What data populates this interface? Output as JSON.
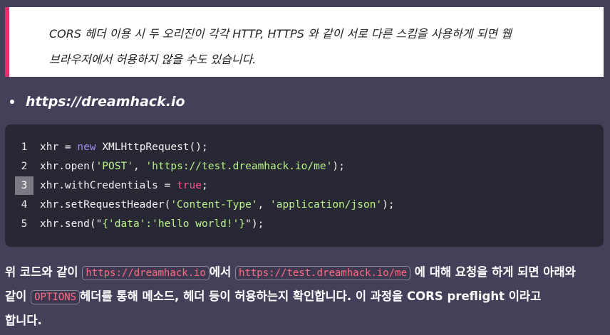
{
  "quote": {
    "line1": "CORS 헤더 이용 시 두 오리진이 각각 HTTP, HTTPS 와 같이 서로 다른 스킴을 사용하게 되면 웹",
    "line2": "브라우저에서 허용하지 않을 수도 있습니다."
  },
  "bullet": {
    "text": "https://dreamhack.io"
  },
  "code": {
    "active_line": 3,
    "lines": [
      {
        "num": "1",
        "p1": "xhr = ",
        "kw": "new",
        "p2": " XMLHttpRequest();"
      },
      {
        "num": "2",
        "p1": "xhr.open(",
        "s1": "'POST'",
        "p2": ", ",
        "s2": "'https://test.dreamhack.io/me'",
        "p3": ");"
      },
      {
        "num": "3",
        "p1": "xhr.withCredentials = ",
        "lit": "true",
        "p2": ";"
      },
      {
        "num": "4",
        "p1": "xhr.setRequestHeader(",
        "s1": "'Content-Type'",
        "p2": ", ",
        "s2": "'application/json'",
        "p3": ");"
      },
      {
        "num": "5",
        "p1": "xhr.send(\"",
        "s1": "{'data':'hello world!'}",
        "p2": "\");"
      }
    ]
  },
  "paragraph": {
    "t1": "위 코드와 같이 ",
    "c1": "https://dreamhack.io",
    "t2": "에서 ",
    "c2": "https://test.dreamhack.io/me",
    "t3": " 에 대해 요청을 하게 되면 아래와",
    "t4": "같이 ",
    "c3": "OPTIONS",
    "t5": "헤더를 통해 메소드, 헤더 등이 허용하는지 확인합니다. 이 과정을 ",
    "t6": "CORS preflight",
    "t7": " 이라고",
    "t8": "합니다."
  },
  "colors": {
    "background": "#45405a",
    "accent": "#e0306e",
    "code_bg": "#282834"
  }
}
